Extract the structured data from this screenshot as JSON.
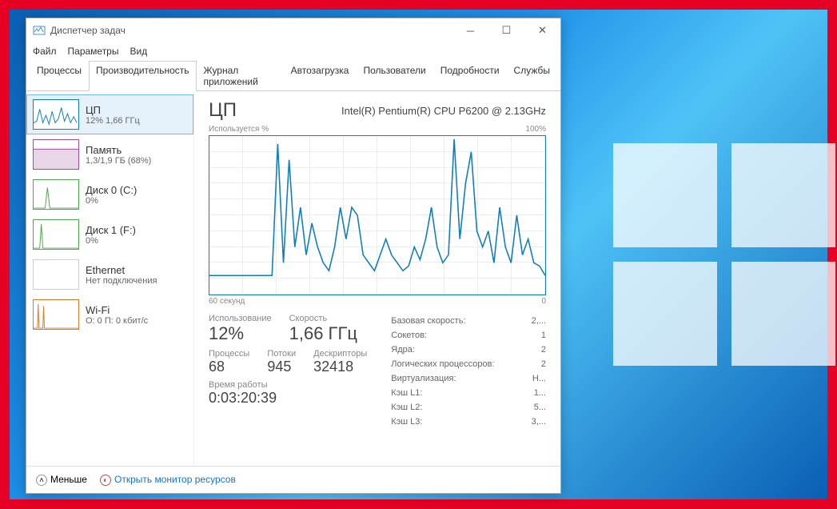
{
  "window_title": "Диспетчер задач",
  "menu": {
    "file": "Файл",
    "options": "Параметры",
    "view": "Вид"
  },
  "tabs": {
    "processes": "Процессы",
    "performance": "Производительность",
    "apphistory": "Журнал приложений",
    "startup": "Автозагрузка",
    "users": "Пользователи",
    "details": "Подробности",
    "services": "Службы"
  },
  "sidebar": {
    "cpu": {
      "title": "ЦП",
      "sub": "12% 1,66 ГГц"
    },
    "mem": {
      "title": "Память",
      "sub": "1,3/1,9 ГБ (68%)"
    },
    "disk0": {
      "title": "Диск 0 (C:)",
      "sub": "0%"
    },
    "disk1": {
      "title": "Диск 1 (F:)",
      "sub": "0%"
    },
    "eth": {
      "title": "Ethernet",
      "sub": "Нет подключения"
    },
    "wifi": {
      "title": "Wi-Fi",
      "sub": "О: 0 П: 0 кбит/с"
    }
  },
  "main": {
    "title": "ЦП",
    "model": "Intel(R) Pentium(R) CPU P6200 @ 2.13GHz",
    "chart_ylabel": "Используется %",
    "chart_ymax": "100%",
    "chart_xlabel": "60 секунд",
    "chart_xmin": "0",
    "stats": {
      "usage_l": "Использование",
      "usage_v": "12%",
      "speed_l": "Скорость",
      "speed_v": "1,66 ГГц",
      "proc_l": "Процессы",
      "proc_v": "68",
      "thr_l": "Потоки",
      "thr_v": "945",
      "hnd_l": "Дескрипторы",
      "hnd_v": "32418",
      "uptime_l": "Время работы",
      "uptime_v": "0:03:20:39"
    },
    "info": {
      "base_l": "Базовая скорость:",
      "base_v": "2,...",
      "sock_l": "Сокетов:",
      "sock_v": "1",
      "cores_l": "Ядра:",
      "cores_v": "2",
      "lproc_l": "Логических процессоров:",
      "lproc_v": "2",
      "virt_l": "Виртуализация:",
      "virt_v": "Н...",
      "l1_l": "Кэш L1:",
      "l1_v": "1...",
      "l2_l": "Кэш L2:",
      "l2_v": "5...",
      "l3_l": "Кэш L3:",
      "l3_v": "3,..."
    }
  },
  "footer": {
    "fewer": "Меньше",
    "monitor": "Открыть монитор ресурсов"
  },
  "chart_data": {
    "type": "line",
    "title": "Используется %",
    "xlabel": "60 секунд",
    "ylabel": "%",
    "ylim": [
      0,
      100
    ],
    "x": [
      0,
      1,
      2,
      3,
      4,
      5,
      6,
      7,
      8,
      9,
      10,
      11,
      12,
      13,
      14,
      15,
      16,
      17,
      18,
      19,
      20,
      21,
      22,
      23,
      24,
      25,
      26,
      27,
      28,
      29,
      30,
      31,
      32,
      33,
      34,
      35,
      36,
      37,
      38,
      39,
      40,
      41,
      42,
      43,
      44,
      45,
      46,
      47,
      48,
      49,
      50,
      51,
      52,
      53,
      54,
      55,
      56,
      57,
      58,
      59
    ],
    "values": [
      12,
      12,
      12,
      12,
      12,
      12,
      12,
      12,
      12,
      12,
      12,
      12,
      95,
      20,
      85,
      30,
      55,
      25,
      45,
      30,
      20,
      15,
      30,
      55,
      35,
      55,
      50,
      25,
      20,
      15,
      25,
      35,
      25,
      20,
      15,
      18,
      30,
      22,
      35,
      55,
      30,
      20,
      25,
      98,
      35,
      70,
      90,
      40,
      30,
      40,
      20,
      55,
      30,
      20,
      50,
      25,
      35,
      20,
      18,
      12
    ]
  }
}
